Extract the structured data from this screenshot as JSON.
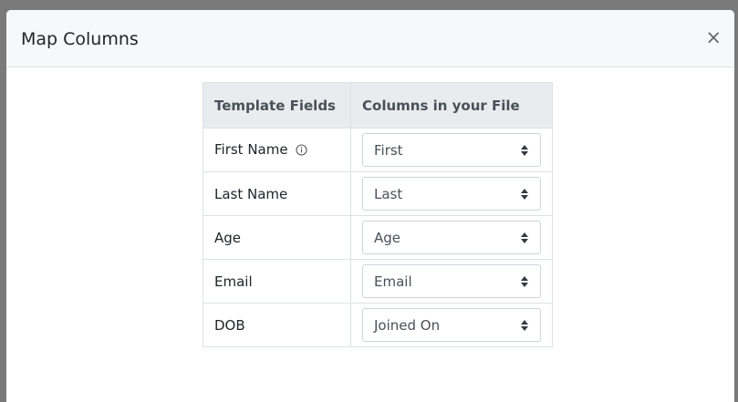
{
  "modal": {
    "title": "Map Columns",
    "close_label": "×"
  },
  "table": {
    "headers": [
      "Template Fields",
      "Columns in your File"
    ],
    "rows": [
      {
        "field": "First Name",
        "info_icon": "info-circle-icon",
        "column": "First"
      },
      {
        "field": "Last Name",
        "column": "Last"
      },
      {
        "field": "Age",
        "column": "Age"
      },
      {
        "field": "Email",
        "column": "Email"
      },
      {
        "field": "DOB",
        "column": "Joined On"
      }
    ]
  }
}
